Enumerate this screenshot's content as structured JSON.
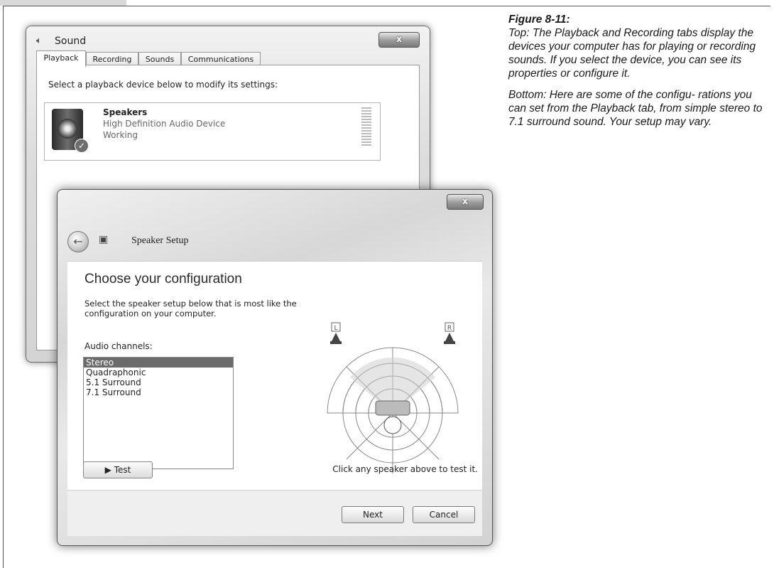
{
  "caption": {
    "figure": "Figure 8-11:",
    "para1": "Top: The Playback and Recording tabs display the devices your computer has for playing or recording sounds. If you select the device, you can see its properties or configure it.",
    "para2": "Bottom: Here are some of the configu- rations you can set from the Playback tab, from simple stereo to 7.1 surround sound. Your setup may vary."
  },
  "sound_window": {
    "title": "Sound",
    "close_label": "x",
    "tabs": [
      "Playback",
      "Recording",
      "Sounds",
      "Communications"
    ],
    "active_tab": "Playback",
    "instruction": "Select a playback device below to modify its settings:",
    "device": {
      "name": "Speakers",
      "description": "High Definition Audio Device",
      "status": "Working"
    }
  },
  "setup_window": {
    "title": "Speaker Setup",
    "close_label": "x",
    "heading": "Choose your configuration",
    "instruction": "Select the speaker setup below that is most like the configuration on your computer.",
    "channels_label": "Audio channels:",
    "channels": [
      "Stereo",
      "Quadraphonic",
      "5.1 Surround",
      "7.1 Surround"
    ],
    "selected_channel": "Stereo",
    "speaker_labels": {
      "left": "L",
      "right": "R"
    },
    "test_label": "▶ Test",
    "test_hint": "Click any speaker above to test it.",
    "next_label": "Next",
    "cancel_label": "Cancel"
  },
  "icons": {
    "sound_window": "speaker-icon",
    "back": "back-arrow-icon",
    "setup": "speaker-setup-icon",
    "device_status": "check-icon"
  }
}
